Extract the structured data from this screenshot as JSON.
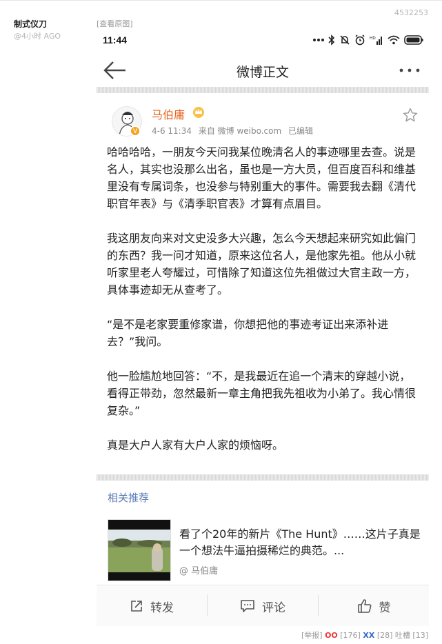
{
  "post": {
    "author": "制式仪刀",
    "time": "@4小时 AGO",
    "view_original": "[查看原图]",
    "id": "4532253"
  },
  "statusbar": {
    "time": "11:44",
    "icons": [
      "dots-icon",
      "bluetooth-icon",
      "mute-icon",
      "alarm-icon",
      "signal-icon",
      "wifi-icon",
      "battery-icon"
    ]
  },
  "nav": {
    "title": "微博正文"
  },
  "weibo": {
    "username": "马伯庸",
    "date": "4-6 11:34",
    "source": "来自 微博 weibo.com",
    "edited": "已编辑",
    "paragraphs": [
      "哈哈哈哈，一朋友今天问我某位晚清名人的事迹哪里去查。说是名人，其实也没那么出名，虽也是一方大员，但百度百科和维基里没有专属词条，也没参与特别重大的事件。需要我去翻《清代职官年表》与《清季职官表》才算有点眉目。",
      "我这朋友向来对文史没多大兴趣，怎么今天想起来研究如此偏门的东西？我一问才知道，原来这位名人，是他家先祖。他从小就听家里老人夸耀过，可惜除了知道这位先祖做过大官主政一方，具体事迹却无从查考了。",
      "“是不是老家要重修家谱，你想把他的事迹考证出来添补进去？”我问。",
      "他一脸尴尬地回答：“不，是我最近在追一个清末的穿越小说，看得正带劲，忽然最新一章主角把我先祖收为小弟了。我心情很复杂。”",
      "真是大户人家有大户人家的烦恼呀。"
    ]
  },
  "recommend": {
    "label": "相关推荐",
    "title": "看了个20年的新片《The Hunt》……这片子真是一个想法牛逼拍摄稀烂的典范。...",
    "author": "@ 马伯庸"
  },
  "actions": {
    "repost": "转发",
    "comment": "评论",
    "like": "赞"
  },
  "footer": {
    "report": "[举报]",
    "oo_label": "OO",
    "oo_count": "[176]",
    "xx_label": "XX",
    "xx_count": "[28]",
    "tucao": "吐槽 [13]"
  },
  "colors": {
    "username": "#e8641f",
    "link_blue": "#5a7bb5",
    "oo": "#e33",
    "xx": "#36c"
  }
}
